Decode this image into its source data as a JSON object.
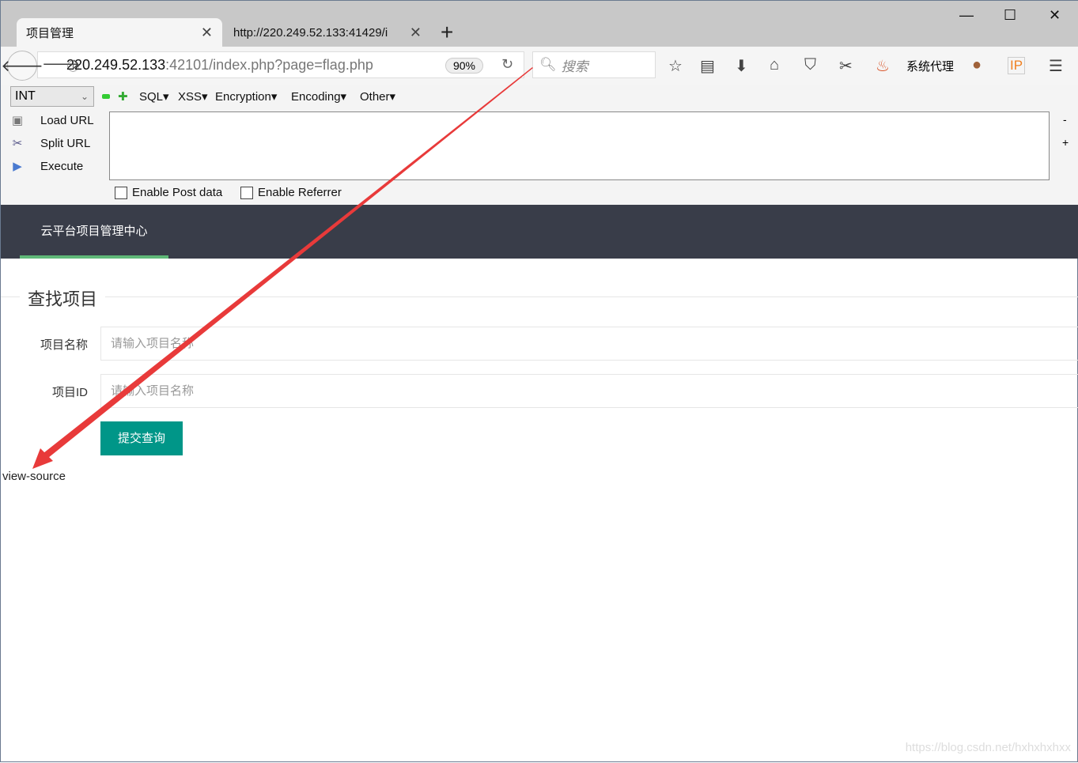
{
  "browser": {
    "tabs": [
      {
        "title": "项目管理"
      },
      {
        "title": "http://220.249.52.133:41429/i"
      }
    ],
    "url_host": "220.249.52.133",
    "url_path": ":42101/index.php?page=flag.php",
    "zoom": "90%",
    "search_placeholder": "搜索",
    "proxy_label": "系统代理",
    "ip_label": "IP"
  },
  "hackbar": {
    "select_value": "INT",
    "menus": [
      "SQL▾",
      "XSS▾",
      "Encryption▾",
      "Encoding▾",
      "Other▾"
    ],
    "actions": [
      "Load URL",
      "Split URL",
      "Execute"
    ],
    "checkboxes": [
      "Enable Post data",
      "Enable Referrer"
    ],
    "minus": "-",
    "plus": "+"
  },
  "page": {
    "brand": "云平台项目管理中心",
    "section_title": "查找项目",
    "fields": [
      {
        "label": "项目名称",
        "placeholder": "请输入项目名称"
      },
      {
        "label": "项目ID",
        "placeholder": "请输入项目名称"
      }
    ],
    "submit": "提交查询",
    "footer_text": "view-source"
  },
  "watermark": "https://blog.csdn.net/hxhxhxhxx",
  "colors": {
    "header": "#393d49",
    "accent": "#5fb878",
    "button": "#009688",
    "arrow": "#e83a3a"
  }
}
